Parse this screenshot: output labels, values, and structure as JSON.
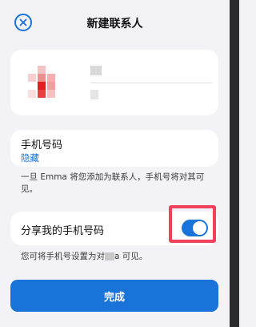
{
  "dialog": {
    "title": "新建联系人",
    "close_icon": "close-circle-icon"
  },
  "name_card": {
    "avatar": "pixelated-avatar",
    "name_redacted": true
  },
  "phone_card": {
    "label": "手机号码",
    "hide_link": "隐藏"
  },
  "phone_note": "一旦 Emma 将您添加为联系人，手机号将对其可见。",
  "share_card": {
    "label": "分享我的手机号码",
    "toggle_on": true
  },
  "share_note_prefix": "您可将手机号设置为对",
  "share_note_suffix": "a 可见。",
  "done_button": "完成",
  "colors": {
    "accent": "#1a73d9",
    "highlight": "#f0425b",
    "background": "#f2f2f7"
  }
}
